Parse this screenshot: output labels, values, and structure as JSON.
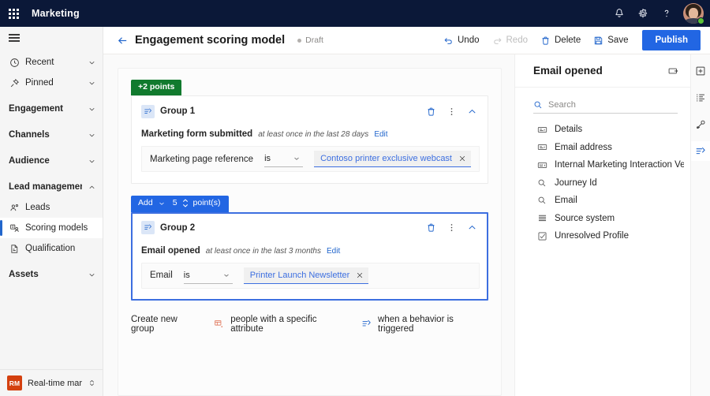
{
  "topbar": {
    "waffle_icon": "app-launcher-icon",
    "app_title": "Marketing",
    "icons": [
      "notification-bell-icon",
      "settings-gear-icon",
      "help-question-icon"
    ],
    "avatar": "user-avatar"
  },
  "sidebar": {
    "hamburger_icon": "hamburger-menu-icon",
    "items": [
      {
        "label": "Recent",
        "icon": "clock-icon",
        "type": "expander",
        "chevron": "down",
        "selected": false
      },
      {
        "label": "Pinned",
        "icon": "pin-icon",
        "type": "expander",
        "chevron": "down",
        "selected": false
      },
      {
        "label": "Engagement",
        "icon": "",
        "type": "group",
        "chevron": "down",
        "selected": false
      },
      {
        "label": "Channels",
        "icon": "",
        "type": "group",
        "chevron": "down",
        "selected": false
      },
      {
        "label": "Audience",
        "icon": "",
        "type": "group",
        "chevron": "down",
        "selected": false
      },
      {
        "label": "Lead management",
        "icon": "",
        "type": "group",
        "chevron": "up",
        "selected": false
      },
      {
        "label": "Leads",
        "icon": "leads-icon",
        "type": "child",
        "chevron": "",
        "selected": false
      },
      {
        "label": "Scoring models",
        "icon": "scoring-icon",
        "type": "child",
        "chevron": "",
        "selected": true
      },
      {
        "label": "Qualification",
        "icon": "qualification-icon",
        "type": "child",
        "chevron": "",
        "selected": false
      },
      {
        "label": "Assets",
        "icon": "",
        "type": "group",
        "chevron": "down",
        "selected": false
      }
    ],
    "footer": {
      "badge": "RM",
      "badge_color": "#d4400f",
      "app_name": "Real-time marketi...",
      "switcher_icon": "app-switcher-icon"
    }
  },
  "commandbar": {
    "back_icon": "back-arrow-icon",
    "title": "Engagement scoring model",
    "status": "Draft",
    "actions": [
      {
        "label": "Undo",
        "icon": "undo-icon",
        "disabled": false
      },
      {
        "label": "Redo",
        "icon": "redo-icon",
        "disabled": true
      },
      {
        "label": "Delete",
        "icon": "delete-icon",
        "disabled": false
      },
      {
        "label": "Save",
        "icon": "save-icon",
        "disabled": false
      }
    ],
    "publish_label": "Publish",
    "publish_color": "#2266e3"
  },
  "canvas": {
    "groups": [
      {
        "badge": {
          "text": "+2 points",
          "color": "#117a2e",
          "kind": "points"
        },
        "icon": "behavior-trigger-icon",
        "title": "Group 1",
        "actions": [
          "delete-icon",
          "more-options-icon",
          "collapse-chevron-icon"
        ],
        "condition": {
          "name": "Marketing form submitted",
          "qualifier": "at least once in the last 28 days",
          "edit_label": "Edit"
        },
        "filter": {
          "label": "Marketing page reference",
          "operator": "is",
          "value": "Contoso printer exclusive webcast",
          "clear_icon": "clear-x-icon"
        },
        "active": false
      },
      {
        "badge": {
          "text_add": "Add",
          "number": "5",
          "text_unit": "point(s)",
          "color": "#2266e3",
          "kind": "add"
        },
        "icon": "behavior-trigger-icon",
        "title": "Group 2",
        "actions": [
          "delete-icon",
          "more-options-icon",
          "collapse-chevron-icon"
        ],
        "condition": {
          "name": "Email opened",
          "qualifier": "at least once in the last 3 months",
          "edit_label": "Edit"
        },
        "filter": {
          "label": "Email",
          "operator": "is",
          "value": "Printer Launch Newsletter",
          "clear_icon": "clear-x-icon"
        },
        "active": true
      }
    ],
    "create_row": {
      "label": "Create new group",
      "options": [
        {
          "label": "people with a specific attribute",
          "icon": "attribute-group-icon"
        },
        {
          "label": "when a behavior is triggered",
          "icon": "behavior-trigger-icon"
        }
      ]
    }
  },
  "rightpanel": {
    "title": "Email opened",
    "detach_icon": "detach-panel-icon",
    "search_placeholder": "Search",
    "search_value": "",
    "search_icon": "search-icon",
    "items": [
      {
        "label": "Details",
        "icon": "text-field-icon"
      },
      {
        "label": "Email address",
        "icon": "text-field-icon"
      },
      {
        "label": "Internal Marketing Interaction Version",
        "icon": "text-field-icon"
      },
      {
        "label": "Journey Id",
        "icon": "lookup-icon"
      },
      {
        "label": "Email",
        "icon": "lookup-icon"
      },
      {
        "label": "Source system",
        "icon": "list-icon"
      },
      {
        "label": "Unresolved Profile",
        "icon": "checkbox-icon"
      }
    ]
  },
  "rail": {
    "buttons": [
      {
        "icon": "add-box-icon",
        "active": false
      },
      {
        "icon": "properties-list-icon",
        "active": false
      },
      {
        "icon": "key-attributes-icon",
        "active": false
      },
      {
        "icon": "behavior-trigger-icon",
        "active": true
      }
    ]
  }
}
